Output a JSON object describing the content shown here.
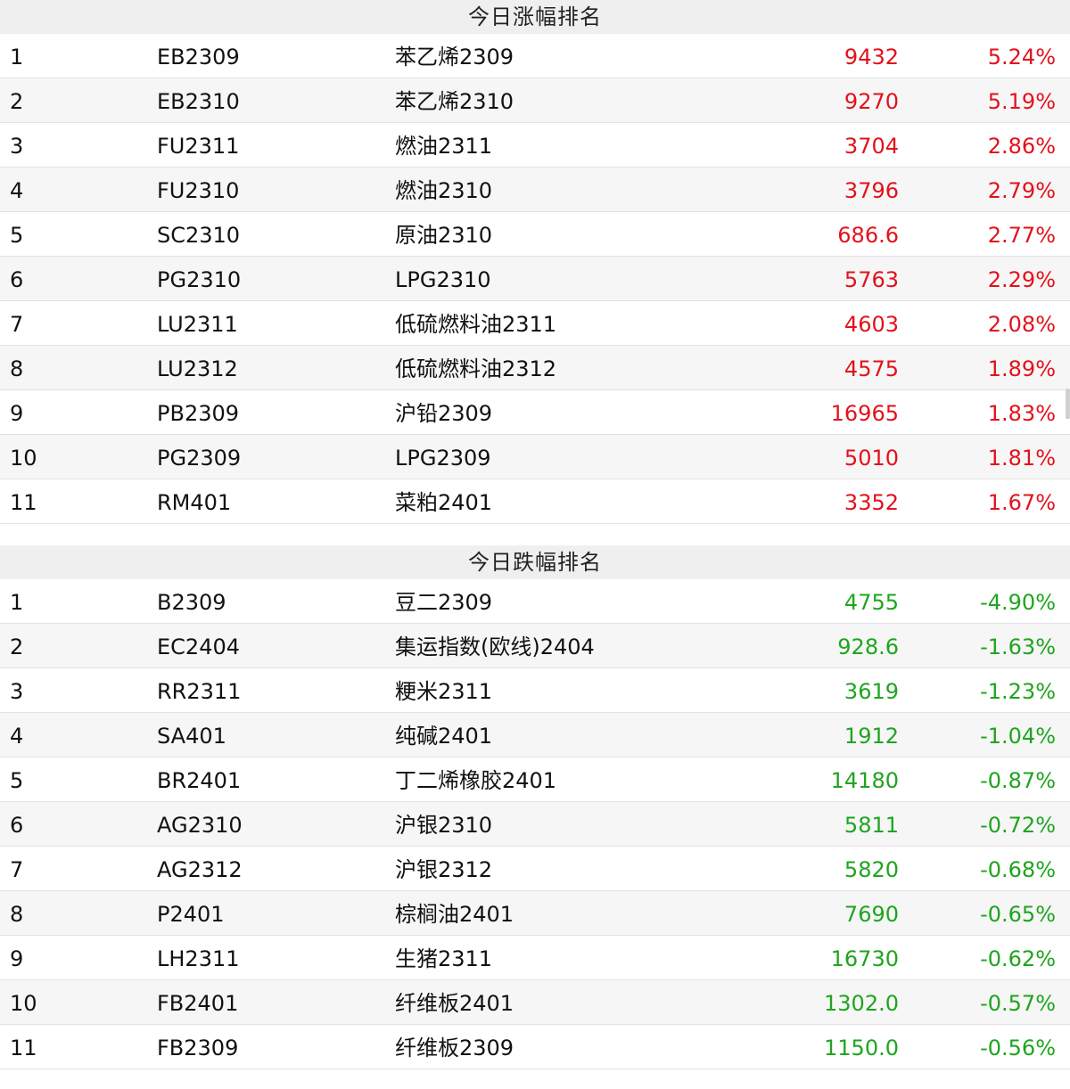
{
  "gainers": {
    "title": "今日涨幅排名",
    "rows": [
      {
        "rank": "1",
        "code": "EB2309",
        "name": "苯乙烯2309",
        "price": "9432",
        "change": "5.24%"
      },
      {
        "rank": "2",
        "code": "EB2310",
        "name": "苯乙烯2310",
        "price": "9270",
        "change": "5.19%"
      },
      {
        "rank": "3",
        "code": "FU2311",
        "name": "燃油2311",
        "price": "3704",
        "change": "2.86%"
      },
      {
        "rank": "4",
        "code": "FU2310",
        "name": "燃油2310",
        "price": "3796",
        "change": "2.79%"
      },
      {
        "rank": "5",
        "code": "SC2310",
        "name": "原油2310",
        "price": "686.6",
        "change": "2.77%"
      },
      {
        "rank": "6",
        "code": "PG2310",
        "name": "LPG2310",
        "price": "5763",
        "change": "2.29%"
      },
      {
        "rank": "7",
        "code": "LU2311",
        "name": "低硫燃料油2311",
        "price": "4603",
        "change": "2.08%"
      },
      {
        "rank": "8",
        "code": "LU2312",
        "name": "低硫燃料油2312",
        "price": "4575",
        "change": "1.89%"
      },
      {
        "rank": "9",
        "code": "PB2309",
        "name": "沪铅2309",
        "price": "16965",
        "change": "1.83%"
      },
      {
        "rank": "10",
        "code": "PG2309",
        "name": "LPG2309",
        "price": "5010",
        "change": "1.81%"
      },
      {
        "rank": "11",
        "code": "RM401",
        "name": "菜粕2401",
        "price": "3352",
        "change": "1.67%"
      }
    ]
  },
  "losers": {
    "title": "今日跌幅排名",
    "rows": [
      {
        "rank": "1",
        "code": "B2309",
        "name": "豆二2309",
        "price": "4755",
        "change": "-4.90%"
      },
      {
        "rank": "2",
        "code": "EC2404",
        "name": "集运指数(欧线)2404",
        "price": "928.6",
        "change": "-1.63%"
      },
      {
        "rank": "3",
        "code": "RR2311",
        "name": "粳米2311",
        "price": "3619",
        "change": "-1.23%"
      },
      {
        "rank": "4",
        "code": "SA401",
        "name": "纯碱2401",
        "price": "1912",
        "change": "-1.04%"
      },
      {
        "rank": "5",
        "code": "BR2401",
        "name": "丁二烯橡胶2401",
        "price": "14180",
        "change": "-0.87%"
      },
      {
        "rank": "6",
        "code": "AG2310",
        "name": "沪银2310",
        "price": "5811",
        "change": "-0.72%"
      },
      {
        "rank": "7",
        "code": "AG2312",
        "name": "沪银2312",
        "price": "5820",
        "change": "-0.68%"
      },
      {
        "rank": "8",
        "code": "P2401",
        "name": "棕榈油2401",
        "price": "7690",
        "change": "-0.65%"
      },
      {
        "rank": "9",
        "code": "LH2311",
        "name": "生猪2311",
        "price": "16730",
        "change": "-0.62%"
      },
      {
        "rank": "10",
        "code": "FB2401",
        "name": "纤维板2401",
        "price": "1302.0",
        "change": "-0.57%"
      },
      {
        "rank": "11",
        "code": "FB2309",
        "name": "纤维板2309",
        "price": "1150.0",
        "change": "-0.56%"
      }
    ]
  },
  "colors": {
    "up": "#e3111b",
    "down": "#1ea51e"
  }
}
